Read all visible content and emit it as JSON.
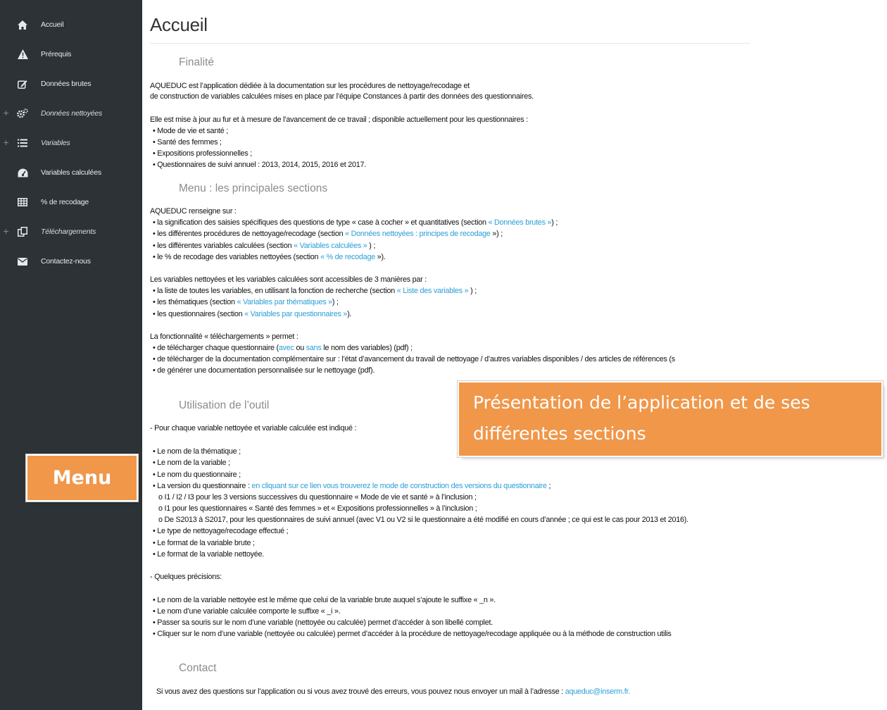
{
  "sidebar": {
    "items": [
      {
        "label": "Accueil",
        "icon": "home-icon",
        "expandable": false,
        "italic": false
      },
      {
        "label": "Prérequis",
        "icon": "warning-icon",
        "expandable": false,
        "italic": false
      },
      {
        "label": "Données brutes",
        "icon": "edit-icon",
        "expandable": false,
        "italic": false
      },
      {
        "label": "Données nettoyées",
        "icon": "gears-icon",
        "expandable": true,
        "italic": true
      },
      {
        "label": "Variables",
        "icon": "list-icon",
        "expandable": true,
        "italic": true
      },
      {
        "label": "Variables calculées",
        "icon": "dashboard-icon",
        "expandable": false,
        "italic": false
      },
      {
        "label": "% de recodage",
        "icon": "table-icon",
        "expandable": false,
        "italic": false
      },
      {
        "label": "Téléchargements",
        "icon": "copy-icon",
        "expandable": true,
        "italic": true
      },
      {
        "label": "Contactez-nous",
        "icon": "envelope-icon",
        "expandable": false,
        "italic": false
      }
    ]
  },
  "main": {
    "title": "Accueil",
    "finalite": {
      "heading": "Finalité",
      "p1": "AQUEDUC est l’application dédiée à la documentation sur les procédures de nettoyage/recodage et",
      "p2": "de construction de variables calculées mises en place par l’équipe Constances à partir des données des questionnaires.",
      "p3": "Elle est mise à jour au fur et à mesure de l’avancement de ce travail ; disponible actuellement pour les questionnaires :",
      "b1": "• Mode de vie et santé ;",
      "b2": "• Santé des femmes ;",
      "b3": "• Expositions professionnelles ;",
      "b4": "• Questionnaires de suivi annuel : 2013, 2014, 2015, 2016 et 2017."
    },
    "menu": {
      "heading": "Menu : les principales sections",
      "intro": "AQUEDUC renseigne sur :",
      "l1_a": "• la signification des saisies spécifiques des questions de type « case à cocher » et quantitatives (section ",
      "l1_link": "« Données brutes »",
      "l1_b": ") ;",
      "l2_a": "• les différentes procédures de nettoyage/recodage (section ",
      "l2_link": "« Données nettoyées : principes de recodage",
      "l2_b": " ») ;",
      "l3_a": "• les différentes variables calculées (section ",
      "l3_link": "« Variables calculées »",
      "l3_b": " ) ;",
      "l4_a": "• le % de recodage des variables nettoyées (section ",
      "l4_link": "« % de recodage",
      "l4_b": " »).",
      "access": "Les variables nettoyées et les variables calculées sont accessibles de 3 manières par :",
      "a1_a": "• la liste de toutes les variables, en utilisant la fonction de recherche (section ",
      "a1_link": "« Liste des variables »",
      "a1_b": " ) ;",
      "a2_a": "• les thématiques (section ",
      "a2_link": "« Variables par thématiques »",
      "a2_b": ") ;",
      "a3_a": "• les questionnaires (section ",
      "a3_link": "« Variables par questionnaires »",
      "a3_b": ").",
      "dl": "La fonctionnalité « téléchargements » permet :",
      "d1_a": "• de télécharger chaque questionnaire (",
      "d1_link1": "avec",
      "d1_mid": " ou ",
      "d1_link2": "sans",
      "d1_b": " le nom des variables) (pdf) ;",
      "d2": "• de télécharger de la documentation complémentaire sur : l’état d’avancement du travail de nettoyage / d’autres variables disponibles / des articles de références (s",
      "d3": "• de générer une documentation personnalisée sur le nettoyage (pdf)."
    },
    "utilisation": {
      "heading": "Utilisation de l’outil",
      "intro": "- Pour chaque variable nettoyée et variable calculée est indiqué :",
      "u1": "• Le nom de la thématique ;",
      "u2": "• Le nom de la variable ;",
      "u3": "• Le nom du questionnaire ;",
      "u4_a": "• La version du questionnaire : ",
      "u4_link": "en cliquant sur ce lien vous trouverez le mode de construction des versions du questionnaire",
      "u4_b": " ;",
      "o1": "o I1 / I2 / I3 pour les 3 versions successives du questionnaire « Mode de vie et santé » à l’inclusion ;",
      "o2": "o I1 pour les questionnaires « Santé des femmes » et « Expositions professionnelles » à l’inclusion ;",
      "o3": "o De S2013 à S2017, pour les questionnaires de suivi annuel (avec V1 ou V2 si le questionnaire a été modifié en cours d’année ; ce qui est le cas pour 2013 et 2016).",
      "u5": "• Le type de nettoyage/recodage effectué ;",
      "u6": "• Le format de la variable brute ;",
      "u7": "• Le format de la variable nettoyée.",
      "prec": "- Quelques précisions:",
      "p1": "• Le nom de la variable nettoyée est le même que celui de la variable brute auquel s’ajoute le suffixe « _n ».",
      "p2": "• Le nom d’une variable calculée comporte le suffixe « _i ».",
      "p3": "• Passer sa souris sur le nom d’une variable (nettoyée ou calculée) permet d’accéder à son libellé complet.",
      "p4": "• Cliquer sur le nom d’une variable (nettoyée ou calculée) permet d’accéder à la procédure de nettoyage/recodage appliquée ou à la méthode de construction utilis"
    },
    "contact": {
      "heading": "Contact",
      "text": "Si vous avez des questions sur l’application ou si vous avez trouvé des erreurs, vous pouvez nous envoyer un mail à l’adresse : ",
      "email": "aqueduc@inserm.fr."
    }
  },
  "callouts": {
    "presentation_line1": "Présentation de l’application et de ses",
    "presentation_line2": "différentes sections",
    "menu": "Menu"
  },
  "colors": {
    "sidebar": "#2c3236",
    "link": "#2a9fd6",
    "callout": "#f0974a",
    "heading": "#8c8c8c"
  }
}
